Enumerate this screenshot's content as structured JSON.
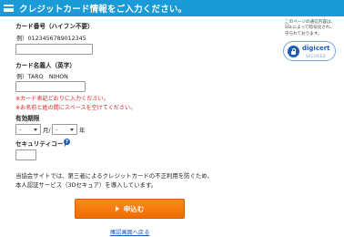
{
  "header": {
    "title": "クレジットカード情報をご入力ください。"
  },
  "card_number": {
    "label": "カード番号（ハイフン不要）",
    "example": "例）0123456789012345",
    "value": ""
  },
  "card_holder": {
    "label": "カード名義人（英字）",
    "example": "例）TARO　NIHON",
    "value": "",
    "notes": [
      "※カード表記どおりに入力ください。",
      "※お名前と姓の間にスペースを空けてください。"
    ]
  },
  "expiry": {
    "label": "有効期限",
    "month_value": "-",
    "month_unit": "月/",
    "year_value": "-",
    "year_unit": "年"
  },
  "security_code": {
    "label": "セキュリティコード",
    "value": ""
  },
  "description": {
    "line1": "当協会サイトでは、第三者によるクレジットカードの不正利用を防ぐため、",
    "line2": "本人認証サービス（3Dセキュア）を導入しています。"
  },
  "submit": {
    "label": "申込む"
  },
  "back_link": {
    "label": "確認画面へ戻る"
  },
  "digicert": {
    "note_lines": [
      "このページの通信内容は、",
      "SSLによって暗号化され、",
      "守られております。"
    ],
    "brand": "digicert",
    "sub": "SECURED"
  },
  "colors": {
    "header_bg": "#1a9ad6",
    "submit_bg": "#f07800",
    "note_red": "#e02020",
    "link_blue": "#1a55c0"
  }
}
